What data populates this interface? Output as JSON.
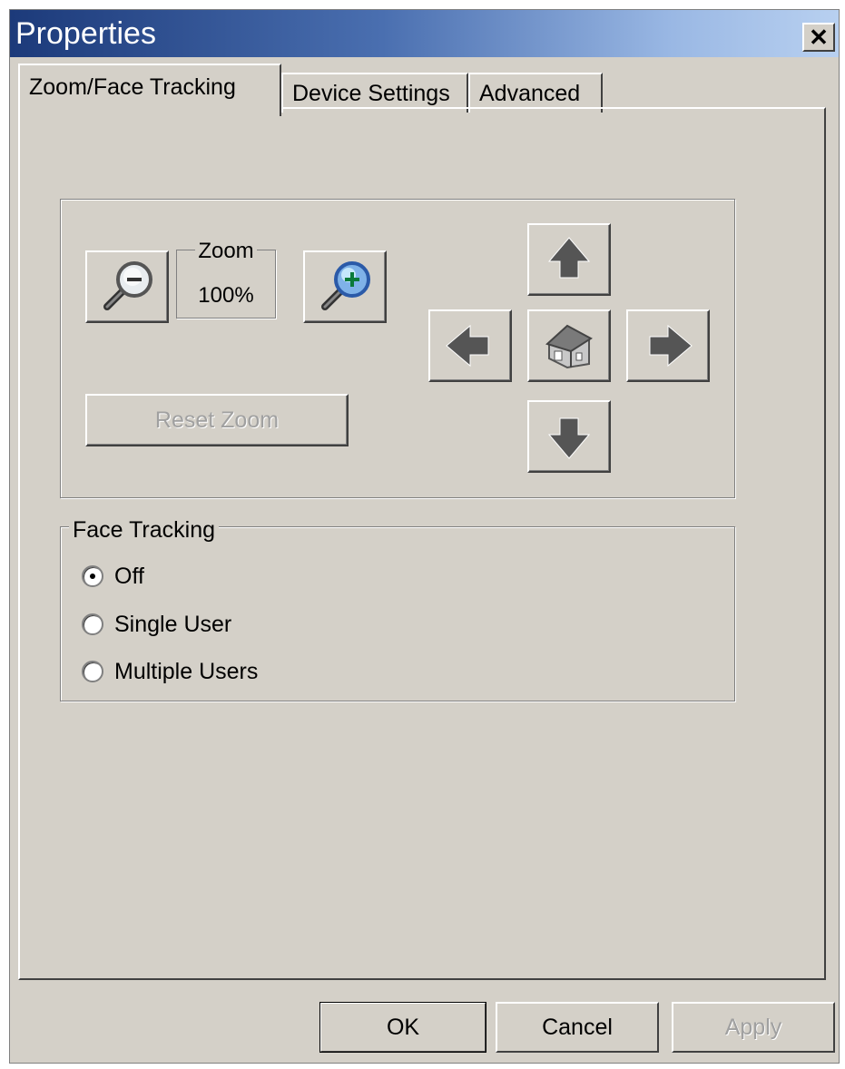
{
  "window": {
    "title": "Properties",
    "close_glyph": "✕"
  },
  "tabs": [
    {
      "label": "Zoom/Face Tracking",
      "active": true
    },
    {
      "label": "Device Settings",
      "active": false
    },
    {
      "label": "Advanced",
      "active": false
    }
  ],
  "zoom": {
    "caption": "Zoom",
    "value": "100%",
    "zoom_out_icon": "magnifier-minus-icon",
    "zoom_in_icon": "magnifier-plus-icon",
    "reset_label": "Reset Zoom",
    "reset_enabled": false
  },
  "pan": {
    "up_icon": "arrow-up-icon",
    "down_icon": "arrow-down-icon",
    "left_icon": "arrow-left-icon",
    "right_icon": "arrow-right-icon",
    "home_icon": "home-icon"
  },
  "face_tracking": {
    "legend": "Face Tracking",
    "options": [
      {
        "label": "Off",
        "selected": true
      },
      {
        "label": "Single User",
        "selected": false
      },
      {
        "label": "Multiple Users",
        "selected": false
      }
    ]
  },
  "buttons": {
    "ok": "OK",
    "cancel": "Cancel",
    "apply": "Apply",
    "apply_enabled": false
  }
}
